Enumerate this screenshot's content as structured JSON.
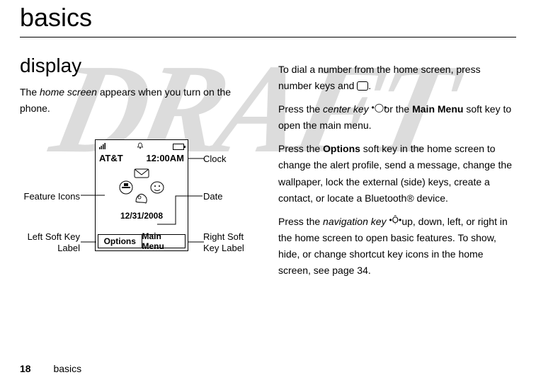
{
  "title": "basics",
  "section_heading": "display",
  "intro_text_parts": {
    "prefix": "The ",
    "italic": "home screen",
    "suffix": " appears when you turn on the phone."
  },
  "diagram": {
    "carrier": "AT&T",
    "clock": "12:00AM",
    "date": "12/31/2008",
    "left_softkey": "Options",
    "right_softkey": "Main Menu",
    "callouts": {
      "clock": "Clock",
      "date": "Date",
      "feature_icons": "Feature Icons",
      "left_softkey_label": "Left Soft Key Label",
      "right_softkey_label": "Right Soft Key Label"
    }
  },
  "paragraphs": {
    "p1_prefix": "To dial a number from the home screen, press number keys and ",
    "p1_suffix": ".",
    "p2_prefix": "Press the ",
    "p2_italic1": "center key ",
    "p2_mid": " or the ",
    "p2_bold": "Main Menu",
    "p2_suffix": " soft key to open the main menu.",
    "p3_prefix": "Press the ",
    "p3_bold": "Options",
    "p3_suffix": " soft key in the home screen to change the alert profile, send a message, change the wallpaper, lock the external (side) keys, create a contact, or locate a Bluetooth® device.",
    "p4_prefix": "Press the ",
    "p4_italic": "navigation key ",
    "p4_suffix": " up, down, left, or right in the home screen to open basic features. To show, hide, or change shortcut key icons in the home screen, see page 34."
  },
  "footer": {
    "page": "18",
    "label": "basics"
  }
}
